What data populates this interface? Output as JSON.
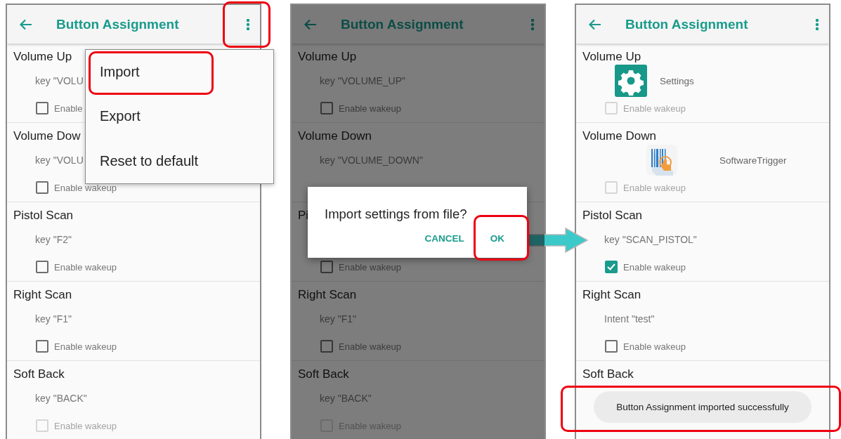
{
  "panels": [
    {
      "title": "Button Assignment",
      "menu_button_highlighted": true,
      "rows": [
        {
          "name": "Volume Up",
          "kind": "text",
          "detail": "key \"VOLU",
          "wakeup": {
            "label": "Enable",
            "checked": false,
            "disabled": false
          }
        },
        {
          "name": "Volume Dow",
          "kind": "text",
          "detail": "key \"VOLU",
          "wakeup": {
            "label": "Enable wakeup",
            "checked": false,
            "disabled": false
          }
        },
        {
          "name": "Pistol Scan",
          "kind": "text",
          "detail": "key \"F2\"",
          "wakeup": {
            "label": "Enable wakeup",
            "checked": false,
            "disabled": false
          }
        },
        {
          "name": "Right Scan",
          "kind": "text",
          "detail": "key \"F1\"",
          "wakeup": {
            "label": "Enable wakeup",
            "checked": false,
            "disabled": false
          }
        },
        {
          "name": "Soft Back",
          "kind": "text",
          "detail": "key \"BACK\"",
          "wakeup": {
            "label": "Enable wakeup",
            "checked": false,
            "disabled": true
          }
        }
      ],
      "menu": {
        "items": [
          {
            "label": "Import",
            "highlighted": true
          },
          {
            "label": "Export",
            "highlighted": false
          },
          {
            "label": "Reset to default",
            "highlighted": false
          }
        ]
      }
    },
    {
      "title": "Button Assignment",
      "dimmed": true,
      "rows": [
        {
          "name": "Volume Up",
          "kind": "text",
          "detail": "key \"VOLUME_UP\"",
          "wakeup": {
            "label": "Enable wakeup",
            "checked": false,
            "disabled": false
          }
        },
        {
          "name": "Volume Down",
          "kind": "text",
          "detail": "key \"VOLUME_DOWN\""
        },
        {
          "name": "Pi",
          "wakeup": {
            "label": "Enable wakeup",
            "checked": false,
            "disabled": false
          }
        },
        {
          "name": "Right Scan",
          "kind": "text",
          "detail": "key \"F1\"",
          "wakeup": {
            "label": "Enable wakeup",
            "checked": false,
            "disabled": false
          }
        },
        {
          "name": "Soft Back",
          "kind": "text",
          "detail": "key \"BACK\"",
          "wakeup": {
            "label": "Enable wakeup",
            "checked": false,
            "disabled": true
          }
        }
      ],
      "dialog": {
        "title": "Import settings from file?",
        "buttons": [
          {
            "label": "CANCEL",
            "highlighted": false
          },
          {
            "label": "OK",
            "highlighted": true
          }
        ]
      }
    },
    {
      "title": "Button Assignment",
      "rows": [
        {
          "name": "Volume Up",
          "kind": "app",
          "detail": "Settings",
          "wakeup": {
            "label": "Enable wakeup",
            "checked": false,
            "disabled": true
          }
        },
        {
          "name": "Volume Down",
          "kind": "app",
          "detail": "SoftwareTrigger",
          "wakeup": {
            "label": "Enable wakeup",
            "checked": false,
            "disabled": true
          }
        },
        {
          "name": "Pistol Scan",
          "kind": "text",
          "detail": "key \"SCAN_PISTOL\"",
          "wakeup": {
            "label": "Enable wakeup",
            "checked": true,
            "disabled": false
          }
        },
        {
          "name": "Right Scan",
          "kind": "text",
          "detail": "Intent \"test\"",
          "wakeup": {
            "label": "Enable wakeup",
            "checked": false,
            "disabled": false
          }
        },
        {
          "name": "Soft Back"
        }
      ],
      "toast": {
        "text": "Button Assignment imported successfully",
        "highlighted": true
      }
    }
  ]
}
